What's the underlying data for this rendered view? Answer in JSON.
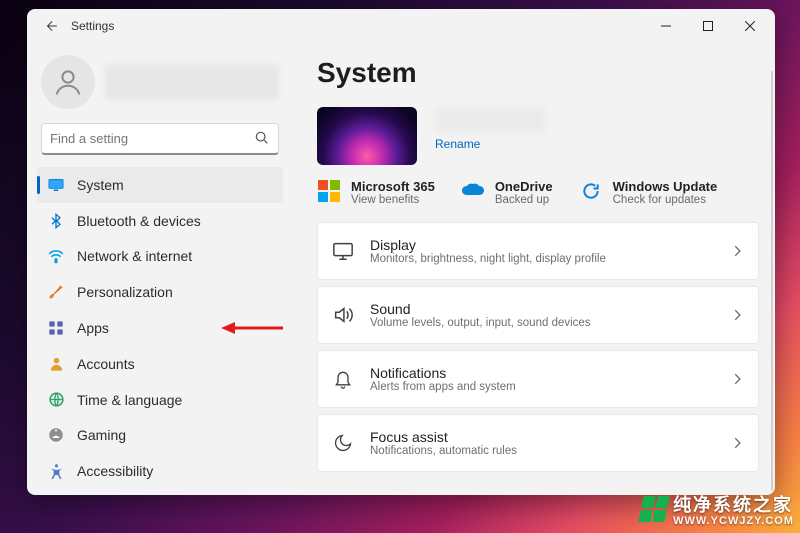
{
  "app_title": "Settings",
  "search": {
    "placeholder": "Find a setting"
  },
  "nav": {
    "items": [
      {
        "label": "System"
      },
      {
        "label": "Bluetooth & devices"
      },
      {
        "label": "Network & internet"
      },
      {
        "label": "Personalization"
      },
      {
        "label": "Apps"
      },
      {
        "label": "Accounts"
      },
      {
        "label": "Time & language"
      },
      {
        "label": "Gaming"
      },
      {
        "label": "Accessibility"
      }
    ]
  },
  "page": {
    "title": "System",
    "rename": "Rename",
    "status": [
      {
        "title": "Microsoft 365",
        "sub": "View benefits"
      },
      {
        "title": "OneDrive",
        "sub": "Backed up"
      },
      {
        "title": "Windows Update",
        "sub": "Check for updates"
      }
    ],
    "cards": [
      {
        "title": "Display",
        "sub": "Monitors, brightness, night light, display profile"
      },
      {
        "title": "Sound",
        "sub": "Volume levels, output, input, sound devices"
      },
      {
        "title": "Notifications",
        "sub": "Alerts from apps and system"
      },
      {
        "title": "Focus assist",
        "sub": "Notifications, automatic rules"
      }
    ]
  },
  "watermark": {
    "cn": "纯净系统之家",
    "en": "WWW.YCWJZY.COM"
  }
}
